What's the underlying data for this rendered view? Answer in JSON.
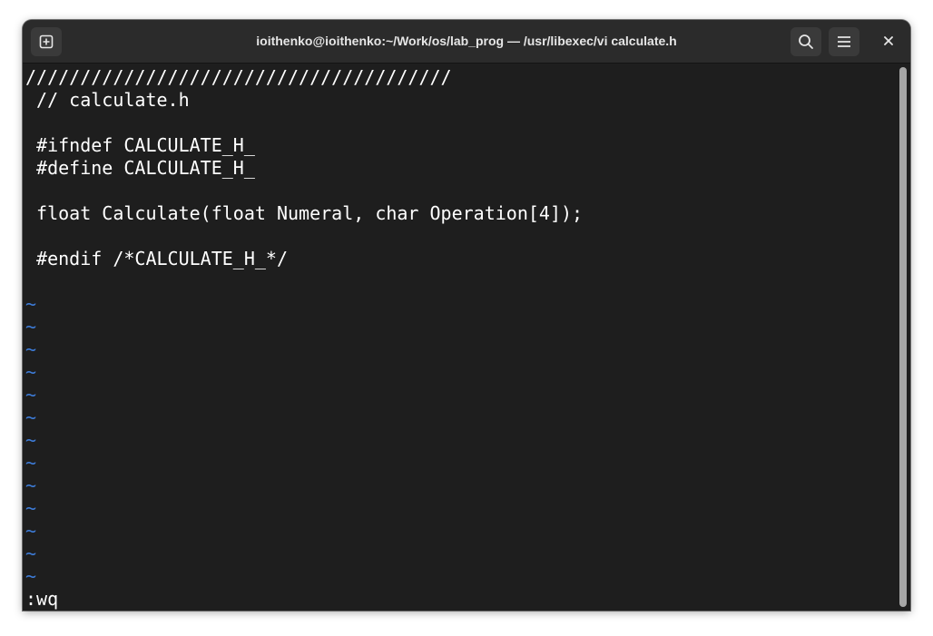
{
  "window": {
    "title": "ioithenko@ioithenko:~/Work/os/lab_prog — /usr/libexec/vi calculate.h"
  },
  "titlebar": {
    "new_tab_icon": "new-tab-icon",
    "search_icon": "search-icon",
    "menu_icon": "hamburger-menu-icon",
    "close_icon": "close-icon"
  },
  "editor": {
    "lines": [
      "///////////////////////////////////////",
      " // calculate.h",
      "",
      " #ifndef CALCULATE_H_",
      " #define CALCULATE_H_",
      "",
      " float Calculate(float Numeral, char Operation[4]);",
      "",
      " #endif /*CALCULATE_H_*/",
      ""
    ],
    "tildes": [
      "~",
      "~",
      "~",
      "~",
      "~",
      "~",
      "~",
      "~",
      "~",
      "~",
      "~",
      "~",
      "~"
    ],
    "command_line": ":wq"
  },
  "colors": {
    "background": "#1e1e1e",
    "text": "#ffffff",
    "tilde": "#3d7bd6",
    "titlebar": "#2b2b2b"
  }
}
